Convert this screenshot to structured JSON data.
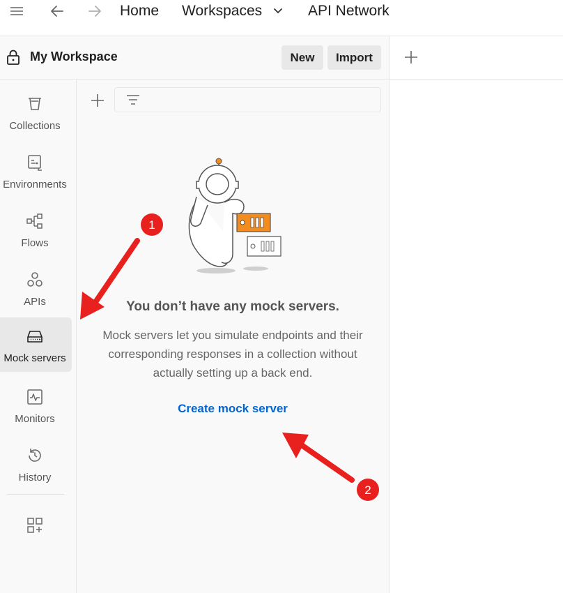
{
  "topbar": {
    "home": "Home",
    "workspaces": "Workspaces",
    "api_network": "API Network"
  },
  "workspace": {
    "title": "My Workspace",
    "new_label": "New",
    "import_label": "Import"
  },
  "sidebar": {
    "items": [
      {
        "label": "Collections",
        "icon": "collections-icon"
      },
      {
        "label": "Environments",
        "icon": "environments-icon"
      },
      {
        "label": "Flows",
        "icon": "flows-icon"
      },
      {
        "label": "APIs",
        "icon": "apis-icon"
      },
      {
        "label": "Mock servers",
        "icon": "mock-servers-icon",
        "active": true
      },
      {
        "label": "Monitors",
        "icon": "monitors-icon"
      },
      {
        "label": "History",
        "icon": "history-icon"
      }
    ]
  },
  "empty_state": {
    "title": "You don’t have any mock servers.",
    "description": "Mock servers let you simulate endpoints and their corresponding responses in a collection without actually setting up a back end.",
    "action": "Create mock server"
  },
  "annotations": {
    "badge1": "1",
    "badge2": "2",
    "color": "#e8201e"
  },
  "colors": {
    "link": "#0265d2",
    "accent": "#f28c1e",
    "active_bg": "#e8e8e8"
  }
}
